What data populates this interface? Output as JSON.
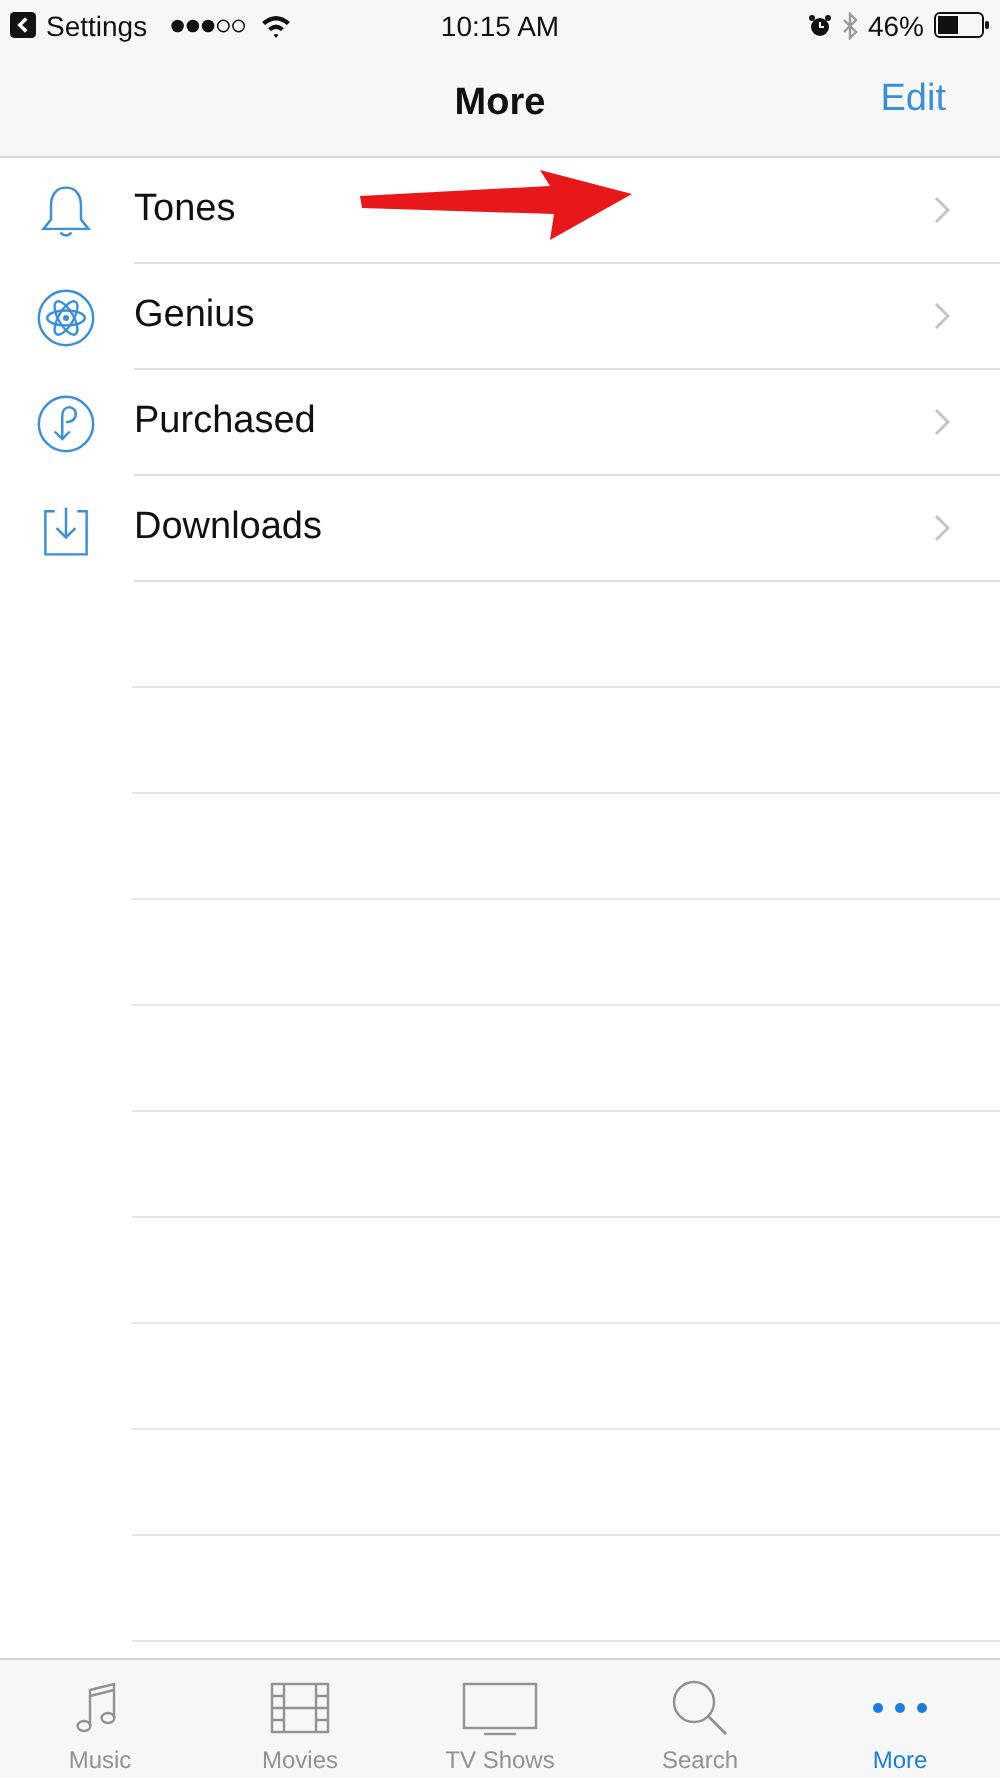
{
  "status_bar": {
    "back_label": "Settings",
    "time": "10:15 AM",
    "battery": "46%"
  },
  "nav": {
    "title": "More",
    "edit": "Edit"
  },
  "items": [
    {
      "label": "Tones",
      "kind": "bell"
    },
    {
      "label": "Genius",
      "kind": "atom"
    },
    {
      "label": "Purchased",
      "kind": "purchased"
    },
    {
      "label": "Downloads",
      "kind": "download"
    }
  ],
  "tab_bar": [
    {
      "label": "Music",
      "kind": "music",
      "selected": false
    },
    {
      "label": "Movies",
      "kind": "film",
      "selected": false
    },
    {
      "label": "TV Shows",
      "kind": "tv",
      "selected": false
    },
    {
      "label": "Search",
      "kind": "search",
      "selected": false
    },
    {
      "label": "More",
      "kind": "more",
      "selected": true
    }
  ]
}
